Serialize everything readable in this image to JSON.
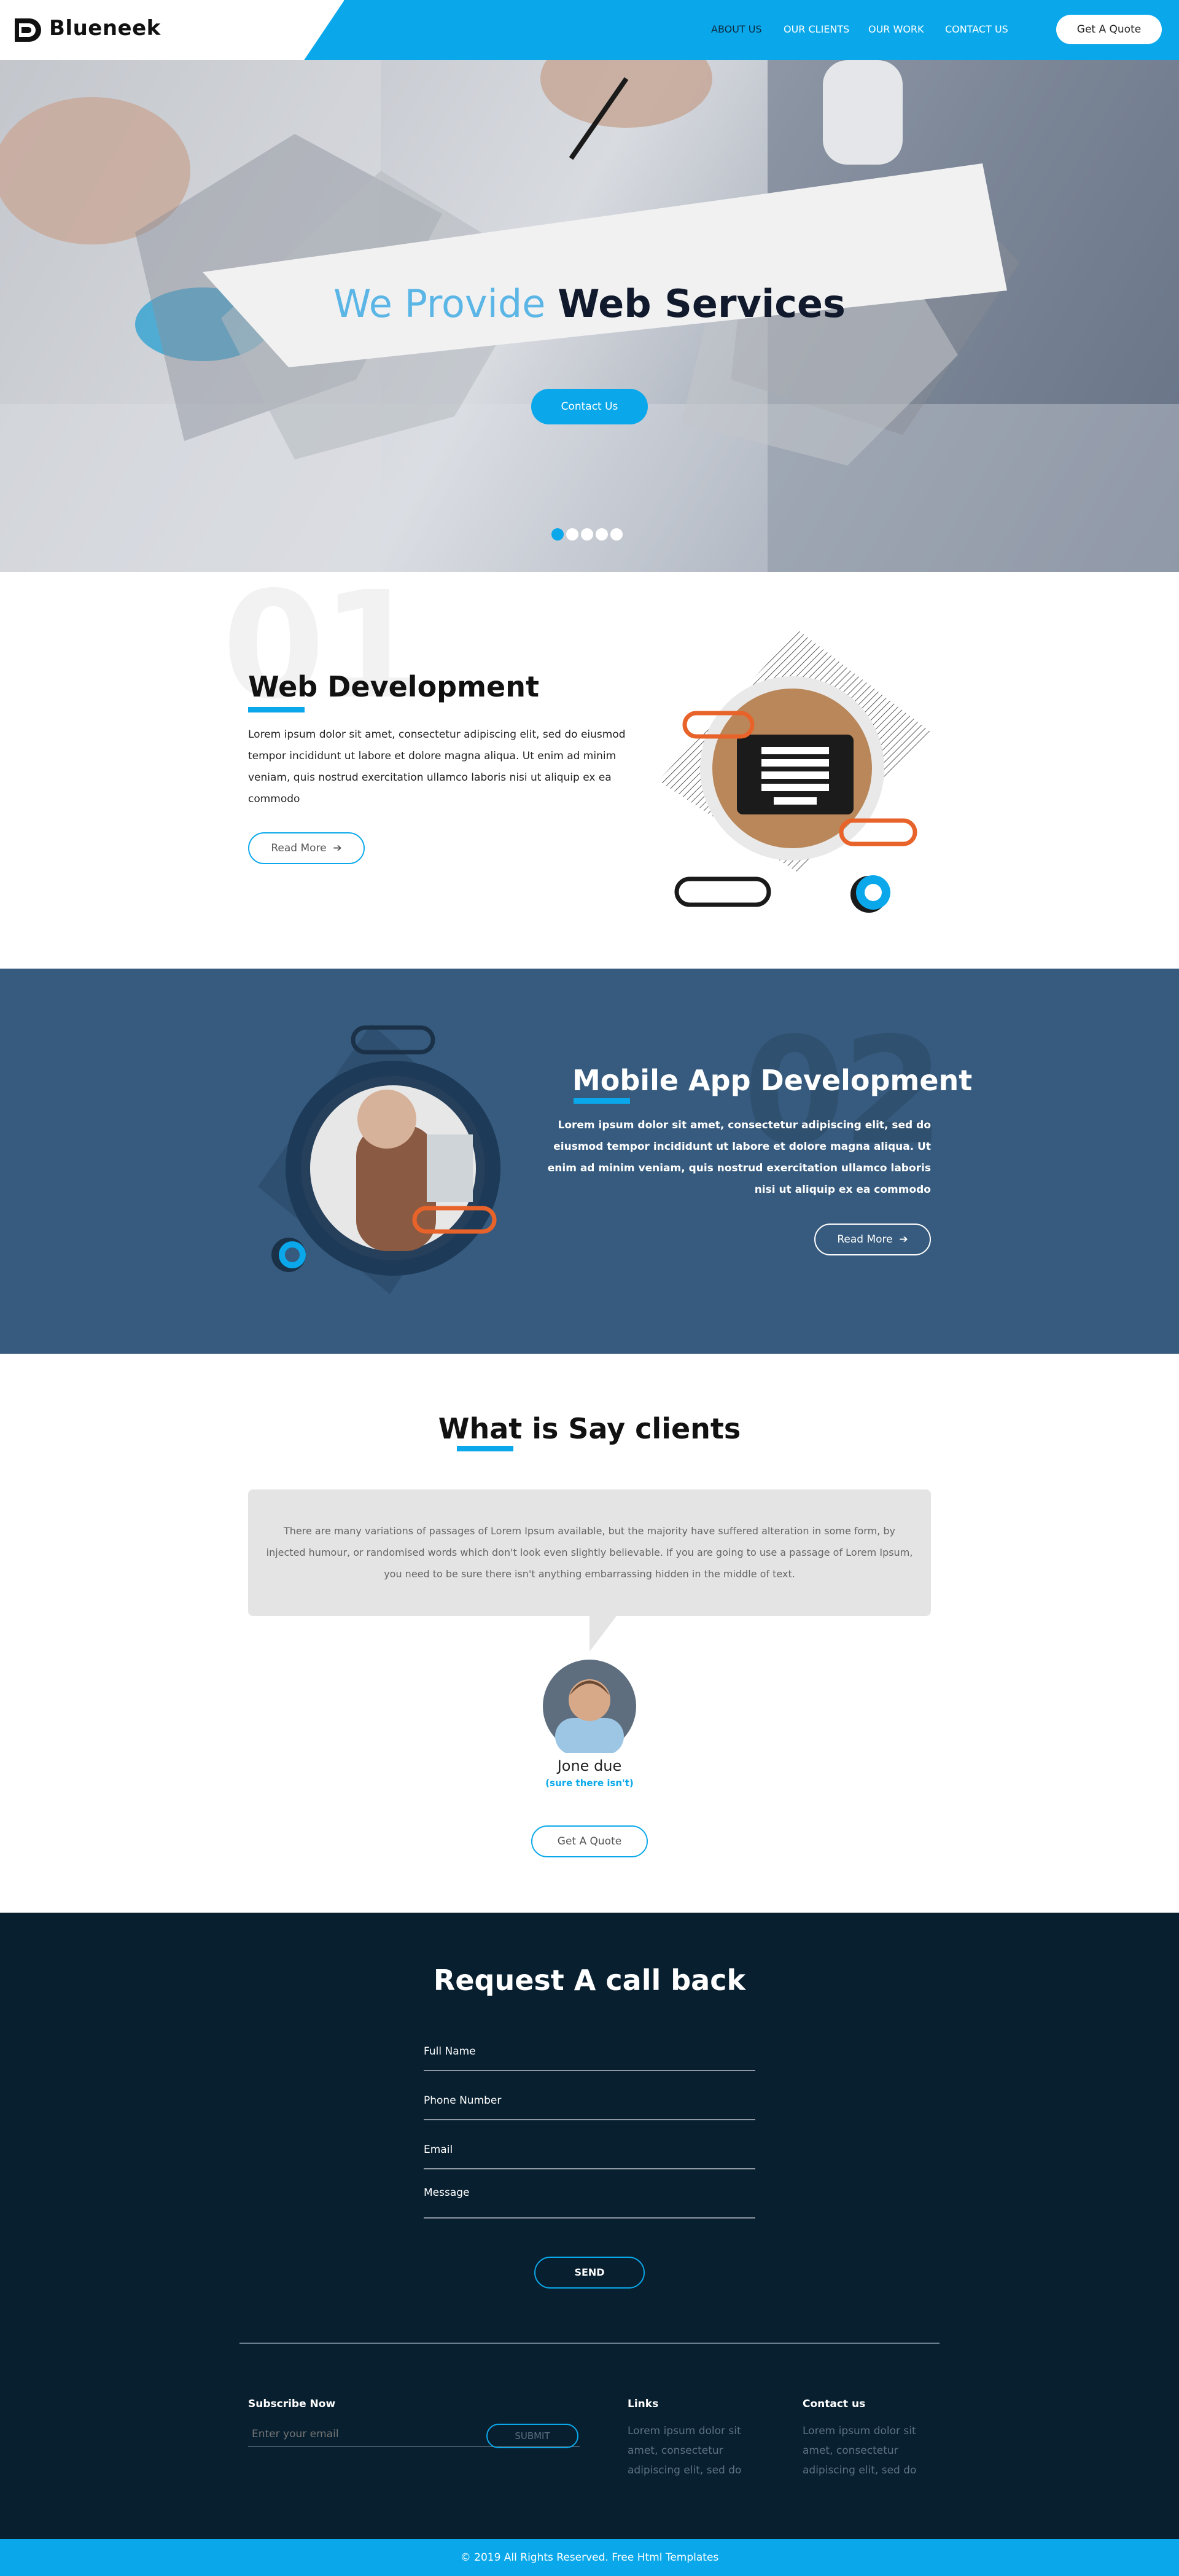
{
  "header": {
    "logo_text": "Blueneek",
    "nav": [
      "ABOUT US",
      "OUR CLIENTS",
      "OUR WORK",
      "CONTACT US"
    ],
    "active_nav": "ABOUT US",
    "quote_button": "Get A Quote"
  },
  "hero": {
    "title_light": "We Provide",
    "title_bold": "Web Services",
    "cta": "Contact Us",
    "slides": 5,
    "active_slide": 1
  },
  "web_dev": {
    "number": "01",
    "title": "Web Development",
    "text": "Lorem ipsum dolor sit amet, consectetur adipiscing elit, sed do eiusmod tempor incididunt ut labore et dolore magna aliqua. Ut enim ad minim veniam, quis nostrud exercitation ullamco laboris nisi ut aliquip ex ea commodo",
    "read_more": "Read More"
  },
  "mobile_dev": {
    "number": "02",
    "title": "Mobile App Development",
    "text": "Lorem ipsum dolor sit amet, consectetur adipiscing elit, sed do eiusmod tempor incididunt ut labore et dolore magna aliqua. Ut enim ad minim veniam, quis nostrud exercitation ullamco laboris nisi ut aliquip ex ea commodo",
    "read_more": "Read More"
  },
  "clients": {
    "title": "What is Say clients",
    "testimonial": "There are many variations of passages of Lorem Ipsum available, but the majority have suffered alteration in some form, by injected humour, or randomised words which don't look even slightly believable. If you are going to use a passage of Lorem Ipsum, you need to be sure there isn't anything embarrassing hidden in the middle of text.",
    "name": "Jone due",
    "subtitle": "(sure there isn't)",
    "button": "Get A Quote"
  },
  "callback": {
    "title": "Request A call back",
    "fields": [
      "Full Name",
      "Phone Number",
      "Email",
      "Message"
    ],
    "send": "SEND"
  },
  "footer": {
    "subscribe_title": "Subscribe Now",
    "email_placeholder": "Enter your email",
    "submit": "SUBMIT",
    "links_title": "Links",
    "links_text": "Lorem ipsum dolor sit amet, consectetur adipiscing elit, sed do",
    "contact_title": "Contact us",
    "contact_text": "Lorem ipsum dolor sit amet, consectetur adipiscing elit, sed do",
    "copyright": "© 2019 All Rights Reserved. Free Html Templates"
  },
  "colors": {
    "accent": "#0aa8ea",
    "mobile_bg": "#365b7e",
    "dark_bg": "#081f2f",
    "orange": "#e8632a"
  }
}
